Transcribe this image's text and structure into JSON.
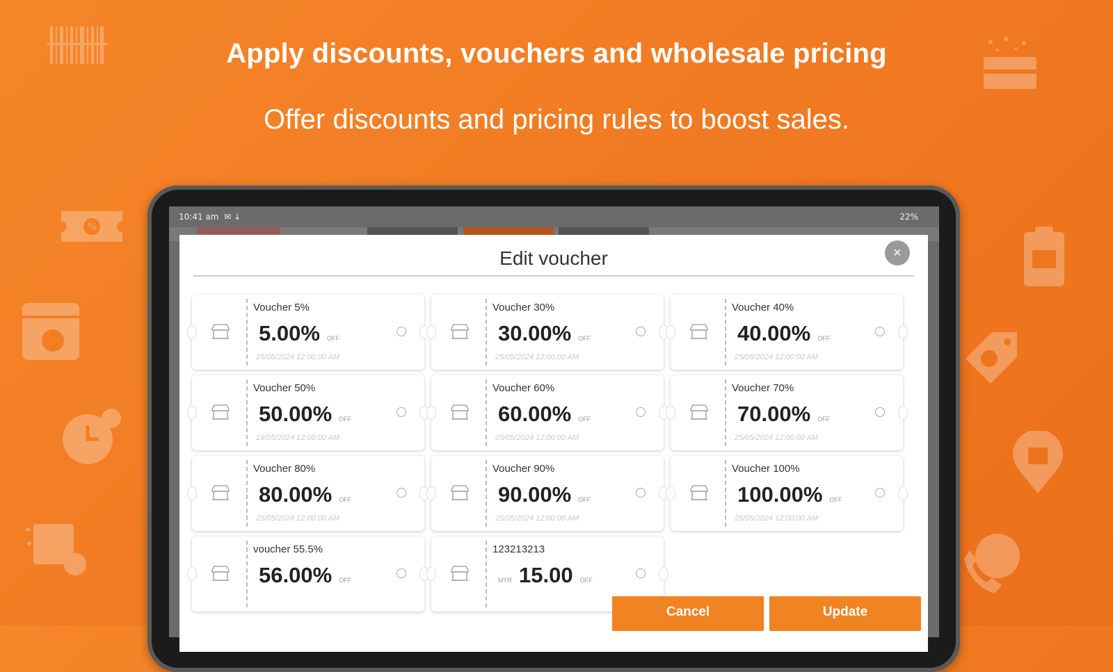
{
  "hero": {
    "headline": "Apply discounts, vouchers and wholesale pricing",
    "subheadline": "Offer discounts and pricing rules to boost sales."
  },
  "status_bar": {
    "time": "10:41 am",
    "indicators": "✉ ↓",
    "battery": "22%"
  },
  "dialog": {
    "title": "Edit voucher",
    "close_label": "×",
    "vouchers": [
      {
        "name": "Voucher 5%",
        "value": "5.00%",
        "suffix": "OFF",
        "date": "25/05/2024 12:00:00 AM"
      },
      {
        "name": "Voucher 30%",
        "value": "30.00%",
        "suffix": "OFF",
        "date": "25/05/2024 12:00:00 AM"
      },
      {
        "name": "Voucher 40%",
        "value": "40.00%",
        "suffix": "OFF",
        "date": "25/05/2024 12:00:00 AM"
      },
      {
        "name": "Voucher 50%",
        "value": "50.00%",
        "suffix": "OFF",
        "date": "19/05/2024 12:00:00 AM"
      },
      {
        "name": "Voucher 60%",
        "value": "60.00%",
        "suffix": "OFF",
        "date": "25/05/2024 12:00:00 AM"
      },
      {
        "name": "Voucher 70%",
        "value": "70.00%",
        "suffix": "OFF",
        "date": "25/05/2024 12:00:00 AM"
      },
      {
        "name": "Voucher 80%",
        "value": "80.00%",
        "suffix": "OFF",
        "date": "25/05/2024 12:00:00 AM"
      },
      {
        "name": "Voucher 90%",
        "value": "90.00%",
        "suffix": "OFF",
        "date": "25/05/2024 12:00:00 AM"
      },
      {
        "name": "Voucher 100%",
        "value": "100.00%",
        "suffix": "OFF",
        "date": "25/05/2024 12:00:00 AM"
      },
      {
        "name": "voucher 55.5%",
        "value": "56.00%",
        "suffix": "OFF",
        "date": ""
      },
      {
        "name": "123213213",
        "currency": "MYR",
        "value": "15.00",
        "suffix": "OFF",
        "date": ""
      }
    ],
    "cancel_label": "Cancel",
    "update_label": "Update"
  },
  "colors": {
    "background": "#f07a22",
    "accent_button": "#f08322",
    "dialog": "#ffffff"
  },
  "icons": [
    "barcode-icon",
    "gift-card-icon",
    "coupon-ticket-icon",
    "browser-check-icon",
    "clipboard-icon",
    "price-tag-icon",
    "clock-24-icon",
    "gift-location-icon",
    "package-location-icon",
    "phone-24-icon",
    "store-icon",
    "radio-icon",
    "close-icon"
  ]
}
